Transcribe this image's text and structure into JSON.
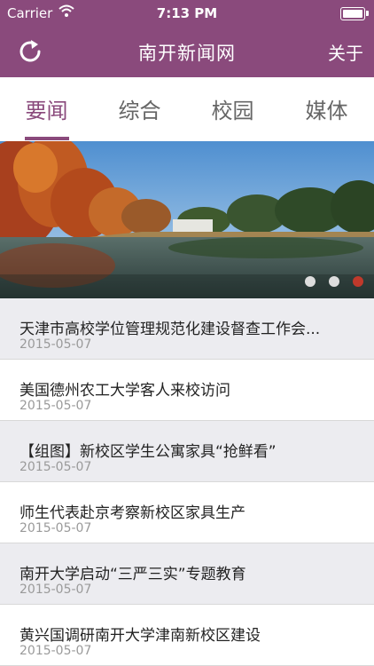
{
  "status_bar": {
    "carrier": "Carrier",
    "time": "7:13 PM"
  },
  "nav": {
    "title": "南开新闻网",
    "about": "关于",
    "refresh_icon": "refresh-icon"
  },
  "tabs": [
    {
      "label": "要闻",
      "active": true
    },
    {
      "label": "综合",
      "active": false
    },
    {
      "label": "校园",
      "active": false
    },
    {
      "label": "媒体",
      "active": false
    }
  ],
  "banner": {
    "page_count": 3,
    "active_index": 2
  },
  "news": [
    {
      "title": "天津市高校学位管理规范化建设督查工作会...",
      "date": "2015-05-07"
    },
    {
      "title": "美国德州农工大学客人来校访问",
      "date": "2015-05-07"
    },
    {
      "title": "【组图】新校区学生公寓家具“抢鲜看”",
      "date": "2015-05-07"
    },
    {
      "title": "师生代表赴京考察新校区家具生产",
      "date": "2015-05-07"
    },
    {
      "title": "南开大学启动“三严三实”专题教育",
      "date": "2015-05-07"
    },
    {
      "title": "黄兴国调研南开大学津南新校区建设",
      "date": "2015-05-07"
    }
  ],
  "colors": {
    "brand": "#8a4a7c",
    "active_dot": "#c0392b",
    "inactive_dot": "#dddddd"
  }
}
